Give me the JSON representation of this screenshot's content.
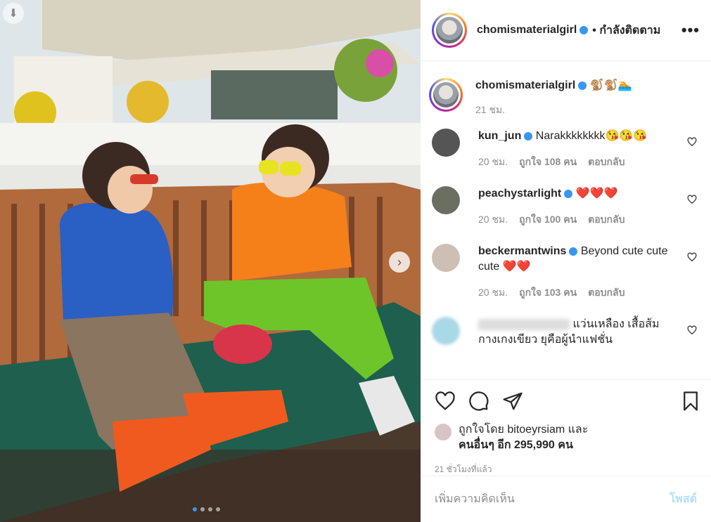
{
  "post": {
    "username": "chomismaterialgirl",
    "following_label": "• กำลังติดตาม",
    "caption_emojis": "🐒🐒🏊",
    "caption_time": "21 ชม.",
    "likes_line1": "ถูกใจโดย bitoeyrsiam และ",
    "likes_line2": "คนอื่นๆ อีก 295,990 คน",
    "posted_ago": "21 ชั่วโมงที่แล้ว",
    "comment_placeholder": "เพิ่มความคิดเห็น",
    "post_button": "โพสต์"
  },
  "comments": [
    {
      "user": "kun_jun",
      "text": "Narakkkkkkkk",
      "emojis": "😘😘😘",
      "time": "20 ชม.",
      "likes": "ถูกใจ 108 คน",
      "reply": "ตอบกลับ"
    },
    {
      "user": "peachystarlight",
      "text": "",
      "emojis": "❤️❤️❤️",
      "time": "20 ชม.",
      "likes": "ถูกใจ 100 คน",
      "reply": "ตอบกลับ"
    },
    {
      "user": "beckermantwins",
      "text": "Beyond cute cute cute",
      "emojis": "❤️❤️",
      "time": "20 ชม.",
      "likes": "ถูกใจ 103 คน",
      "reply": "ตอบกลับ"
    },
    {
      "user": "",
      "text": "แว่นเหลือง เสื้อส้ม กางเกงเขียว ยุคือผู้นำแฟชั่น",
      "emojis": "",
      "time": "",
      "likes": "",
      "reply": ""
    }
  ],
  "carousel": {
    "count": 4,
    "active": 1
  },
  "icons": [
    "download-icon",
    "heart-icon",
    "comment-icon",
    "share-icon",
    "bookmark-icon",
    "more-icon",
    "chevron-right-icon",
    "verified-icon"
  ],
  "colors": {
    "verified": "#3897f0",
    "muted": "#8e8e8e",
    "post_button": "#b2dffc"
  }
}
